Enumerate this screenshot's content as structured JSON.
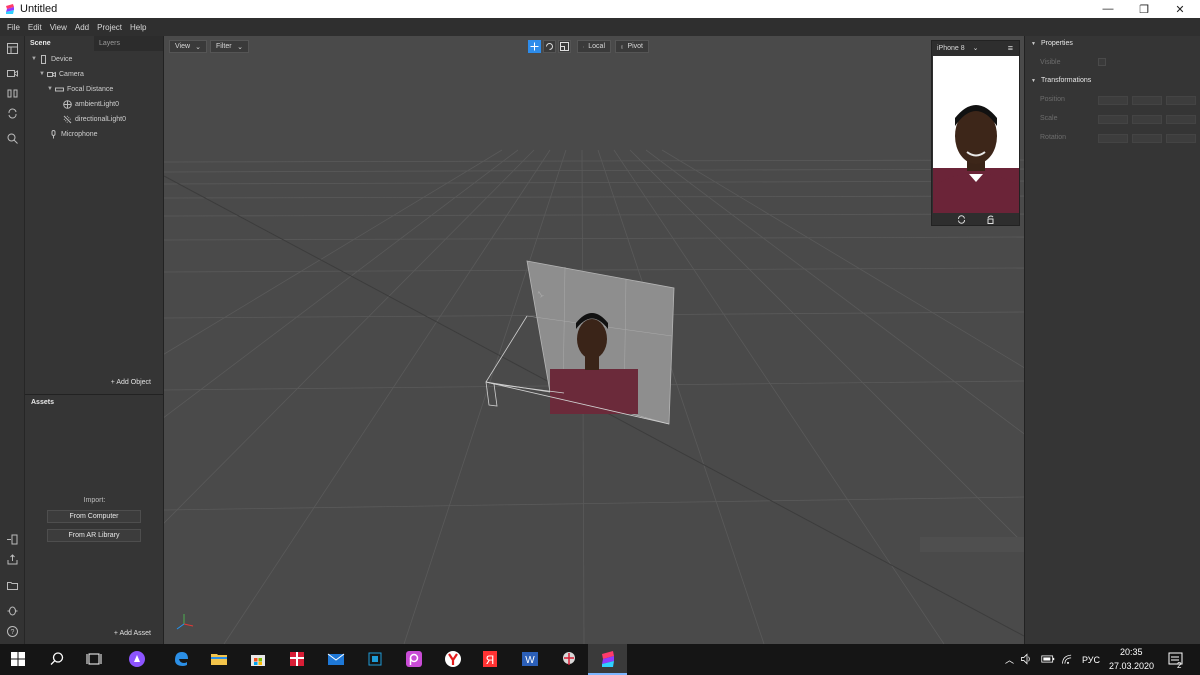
{
  "window": {
    "title": "Untitled",
    "minimize_glyph": "—",
    "maximize_glyph": "❐",
    "close_glyph": "✕"
  },
  "menu": [
    "File",
    "Edit",
    "View",
    "Add",
    "Project",
    "Help"
  ],
  "left_tools": [
    "layout-icon",
    "camera-video-icon",
    "columns-icon",
    "refresh-icon",
    "zoom-icon",
    "import-device-icon",
    "export-icon",
    "folder-icon",
    "bug-icon",
    "help-icon"
  ],
  "scene": {
    "tabs": [
      "Scene",
      "Layers"
    ],
    "items": [
      {
        "label": "Device",
        "icon": "device-icon",
        "arrow": "▼"
      },
      {
        "label": "Camera",
        "icon": "camera-icon",
        "arrow": "▼"
      },
      {
        "label": "Focal Distance",
        "icon": "focal-distance-icon",
        "arrow": "▼"
      },
      {
        "label": "ambientLight0",
        "icon": "ambient-light-icon",
        "arrow": ""
      },
      {
        "label": "directionalLight0",
        "icon": "directional-light-icon",
        "arrow": ""
      },
      {
        "label": "Microphone",
        "icon": "microphone-icon",
        "arrow": ""
      }
    ],
    "add_object": "+  Add Object"
  },
  "assets": {
    "title": "Assets",
    "import_label": "Import:",
    "from_computer": "From Computer",
    "from_ar_library": "From AR Library",
    "add_asset": "+  Add Asset"
  },
  "viewport": {
    "view_label": "View",
    "filter_label": "Filter",
    "local_label": "Local",
    "pivot_label": "Pivot",
    "dropdown_glyph": "⌄"
  },
  "preview": {
    "device": "iPhone 8",
    "dropdown_glyph": "⌄",
    "menu_glyph": "≡"
  },
  "properties": {
    "section1": "Properties",
    "visible": "Visible",
    "section2": "Transformations",
    "position": "Position",
    "scale": "Scale",
    "rotation": "Rotation",
    "triangle": "▼"
  },
  "taskbar": {
    "language": "РУС",
    "time": "20:35",
    "date": "27.03.2020",
    "notifications": "2",
    "tray_arrow": "︿"
  },
  "colors": {
    "accent": "#2d8ceb",
    "viewport_bg": "#4a4a4a",
    "panel_bg": "#353535",
    "taskbar_bg": "#151515"
  }
}
